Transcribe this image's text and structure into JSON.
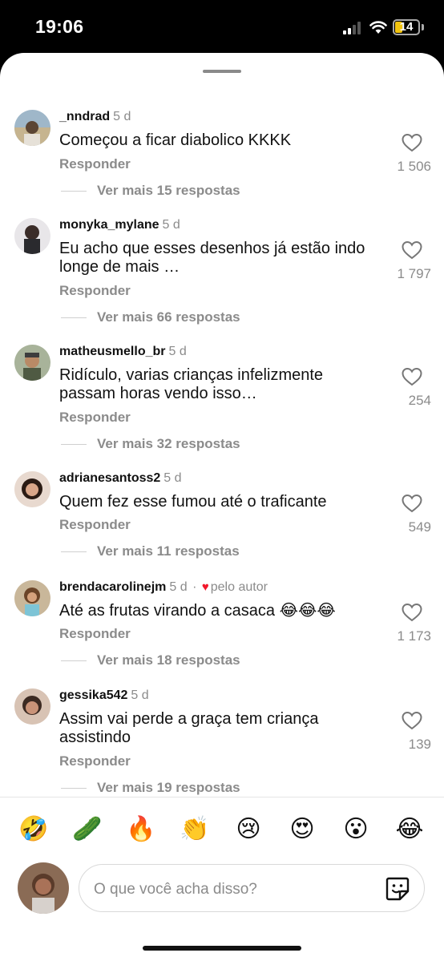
{
  "status": {
    "time": "19:06",
    "battery": "14"
  },
  "comments": [
    {
      "username": "_nndrad",
      "time": "5 d",
      "text": "Começou a ficar diabolico KKKK",
      "reply": "Responder",
      "more": "Ver mais 15 respostas",
      "likes": "1 506"
    },
    {
      "username": "monyka_mylane",
      "time": "5 d",
      "text": "Eu acho que esses desenhos já estão indo longe de mais …",
      "reply": "Responder",
      "more": "Ver mais 66 respostas",
      "likes": "1 797"
    },
    {
      "username": "matheusmello_br",
      "time": "5 d",
      "text": "Ridículo, varias crianças infelizmente passam horas vendo isso…",
      "reply": "Responder",
      "more": "Ver mais 32 respostas",
      "likes": "254"
    },
    {
      "username": "adrianesantoss2",
      "time": "5 d",
      "text": "Quem fez esse fumou até o traficante",
      "reply": "Responder",
      "more": "Ver mais 11 respostas",
      "likes": "549"
    },
    {
      "username": "brendacarolinejm",
      "time": "5 d",
      "author_badge": "pelo autor",
      "text": "Até as frutas virando a casaca 😂😂😂",
      "reply": "Responder",
      "more": "Ver mais 18 respostas",
      "likes": "1 173"
    },
    {
      "username": "gessika542",
      "time": "5 d",
      "text": "Assim vai perde a graça tem criança assistindo",
      "reply": "Responder",
      "more": "Ver mais 19 respostas",
      "likes": "139"
    }
  ],
  "emojis": [
    "🤣",
    "🥒",
    "🔥",
    "👏",
    "😢",
    "😍",
    "😮",
    "😂"
  ],
  "composer": {
    "placeholder": "O que você acha disso?"
  },
  "colors": {
    "accent_heart": "#f2182b",
    "muted_text": "#8b8b8b"
  }
}
